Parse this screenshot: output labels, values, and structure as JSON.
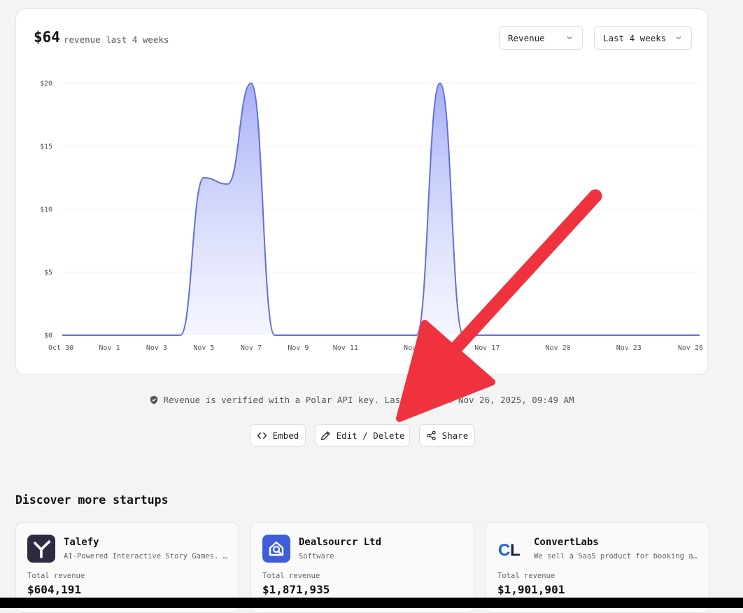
{
  "header": {
    "total": "$64",
    "total_label": "revenue last 4 weeks",
    "metric_select": "Revenue",
    "period_select": "Last 4 weeks"
  },
  "chart_data": {
    "type": "area",
    "title": "",
    "xlabel": "",
    "ylabel": "",
    "y_ticks": [
      "$0",
      "$5",
      "$10",
      "$15",
      "$20"
    ],
    "ylim": [
      0,
      20
    ],
    "x_ticks": [
      "Oct 30",
      "Nov 1",
      "Nov 3",
      "Nov 5",
      "Nov 7",
      "Nov 9",
      "Nov 11",
      "Nov 14",
      "Nov 17",
      "Nov 20",
      "Nov 23",
      "Nov 26"
    ],
    "x_range": [
      "2025-10-30",
      "2025-11-26"
    ],
    "series": [
      {
        "x": [
          "2025-10-30",
          "2025-10-31",
          "2025-11-01",
          "2025-11-02",
          "2025-11-03",
          "2025-11-04",
          "2025-11-05",
          "2025-11-06",
          "2025-11-07",
          "2025-11-08",
          "2025-11-09",
          "2025-11-10",
          "2025-11-11",
          "2025-11-12",
          "2025-11-13",
          "2025-11-14",
          "2025-11-15",
          "2025-11-16",
          "2025-11-17",
          "2025-11-18",
          "2025-11-19",
          "2025-11-20",
          "2025-11-21",
          "2025-11-22",
          "2025-11-23",
          "2025-11-24",
          "2025-11-25",
          "2025-11-26"
        ],
        "values": [
          0,
          0,
          0,
          0,
          0,
          0,
          12.5,
          12,
          20,
          0,
          0,
          0,
          0,
          0,
          0,
          0,
          20,
          0,
          0,
          0,
          0,
          0,
          0,
          0,
          0,
          0,
          0,
          0
        ]
      }
    ],
    "grid": true,
    "line_color": "#6470d6",
    "fill_color": "#a7b0f7"
  },
  "verification": {
    "text": "Revenue is verified with a Polar API key. Last updated: Nov 26, 2025, 09:49 AM"
  },
  "actions": {
    "embed": "Embed",
    "edit": "Edit / Delete",
    "share": "Share"
  },
  "discover": {
    "title": "Discover more startups",
    "total_revenue_label": "Total revenue",
    "startups": [
      {
        "name": "Talefy",
        "description": "AI-Powered Interactive Story Games. Immerse yourself in stories",
        "revenue": "$604,191",
        "logo_icon": "talefy-logo",
        "logo_color": "#2f2a40"
      },
      {
        "name": "Dealsourcr Ltd",
        "description": "Software",
        "revenue": "$1,871,935",
        "logo_icon": "search-house-logo",
        "logo_color": "#3d5ed8"
      },
      {
        "name": "ConvertLabs",
        "description": "We sell a SaaS product for booking and scheduling",
        "revenue": "$1,901,901",
        "logo_text": "CL",
        "logo_color": "#1a5fd6"
      }
    ]
  },
  "annotation": {
    "arrow_color": "#f0323f"
  }
}
